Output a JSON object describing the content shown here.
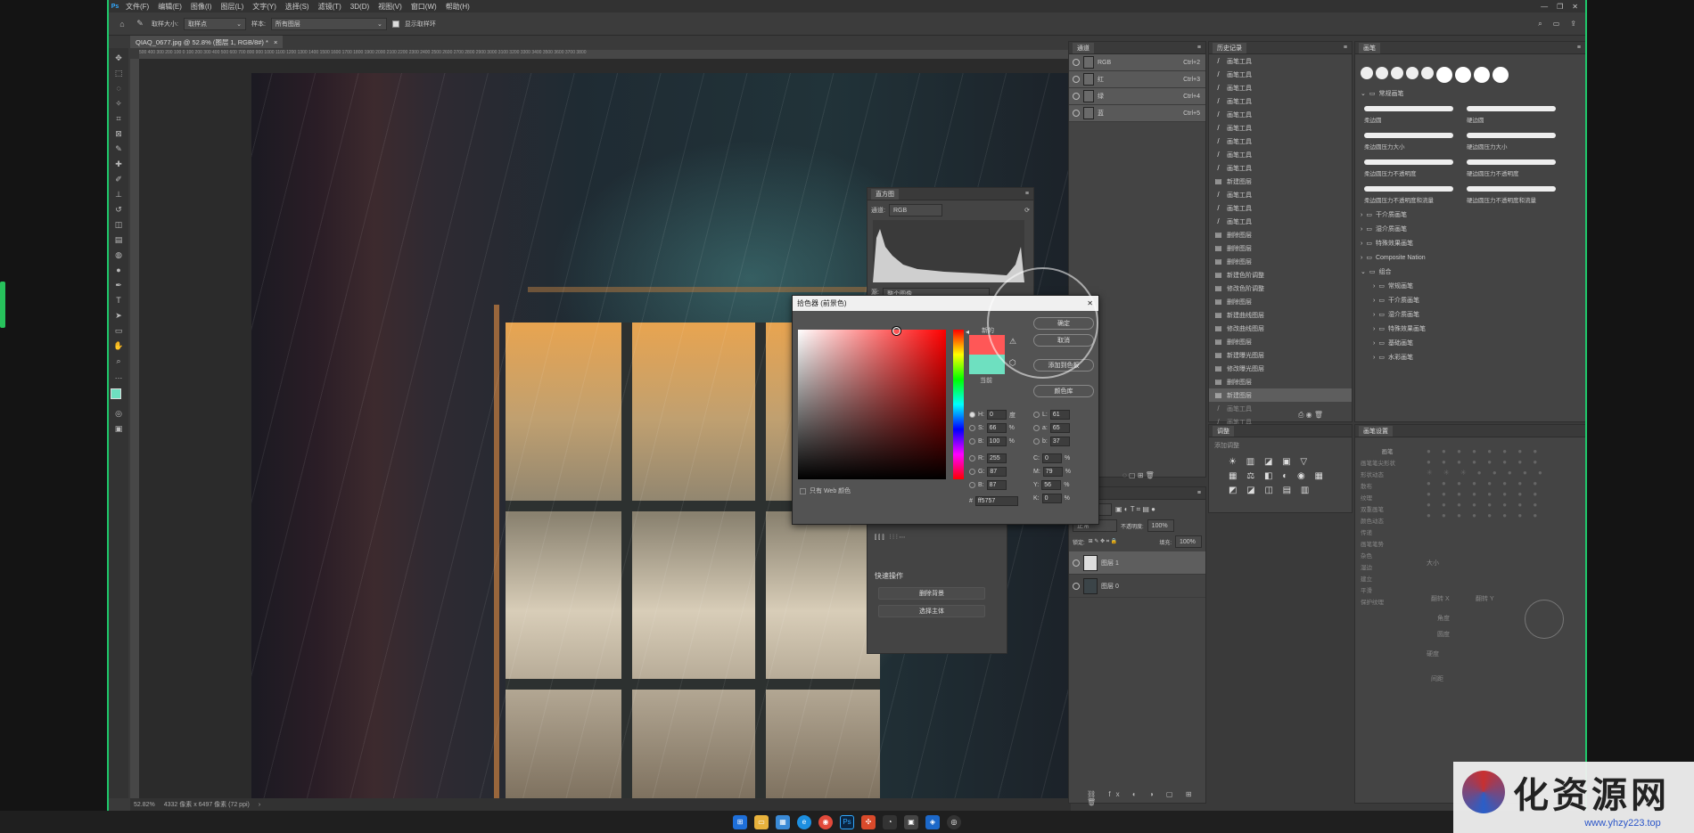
{
  "menu": [
    "文件(F)",
    "编辑(E)",
    "图像(I)",
    "图层(L)",
    "文字(Y)",
    "选择(S)",
    "滤镜(T)",
    "3D(D)",
    "视图(V)",
    "窗口(W)",
    "帮助(H)"
  ],
  "options": {
    "sample_size_label": "取样大小:",
    "sample_size": "取样点",
    "sample_label": "样本:",
    "sample": "所有图层",
    "show_ring": "显示取样环"
  },
  "doc_tab": "QIAQ_0677.jpg @ 52.8% (图层 1, RGB/8#) *",
  "ruler_text": "500  400  300  200  100  0  100  200  300  400  500  600  700  800  900  1000  1100  1200  1300  1400  1500  1600  1700  1800  1900  2000  2100  2200  2300  2400  2500  2600  2700  2800  2900  3000  3100  3200  3300  3400  3500  3600  3700  3800",
  "status": {
    "zoom": "52.82%",
    "info": "4332 像素 x 6497 像素 (72 ppi)"
  },
  "channels": {
    "tab": "通道",
    "rows": [
      {
        "name": "RGB",
        "key": "Ctrl+2"
      },
      {
        "name": "红",
        "key": "Ctrl+3"
      },
      {
        "name": "绿",
        "key": "Ctrl+4"
      },
      {
        "name": "蓝",
        "key": "Ctrl+5"
      }
    ]
  },
  "history": {
    "tab": "历史记录",
    "items": [
      "画笔工具",
      "画笔工具",
      "画笔工具",
      "画笔工具",
      "画笔工具",
      "画笔工具",
      "画笔工具",
      "画笔工具",
      "画笔工具",
      "新建图层",
      "画笔工具",
      "画笔工具",
      "画笔工具",
      "删除图层",
      "删除图层",
      "删除图层",
      "新建色阶调整",
      "修改色阶调整",
      "删除图层",
      "新建曲线图层",
      "修改曲线图层",
      "删除图层",
      "新建曝光图层",
      "修改曝光图层",
      "删除图层",
      "新建图层",
      "画笔工具",
      "画笔工具"
    ]
  },
  "brushes": {
    "tab": "画笔",
    "groups": [
      "常规画笔",
      "干介质画笔",
      "湿介质画笔",
      "特殊效果画笔",
      "Composite Nation",
      "组合"
    ],
    "sub": [
      "常规画笔",
      "干介质画笔",
      "湿介质画笔",
      "特殊效果画笔",
      "基础画笔",
      "水彩画笔"
    ],
    "strokes": [
      "柔边圆",
      "硬边圆",
      "柔边圆压力大小",
      "硬边圆压力大小",
      "柔边圆压力不透明度",
      "硬边圆压力不透明度",
      "柔边圆压力不透明度和流量",
      "硬边圆压力不透明度和流量"
    ]
  },
  "histogram": {
    "tab": "直方图",
    "channel_label": "通道:",
    "channel": "RGB",
    "source": "整个图像"
  },
  "adjust": {
    "tab": "调整",
    "label": "添加调整"
  },
  "layers": {
    "tab": "图层",
    "kind": "类型",
    "mode": "正常",
    "opacity_label": "不透明度:",
    "opacity": "100%",
    "lock_label": "锁定:",
    "fill_label": "填充:",
    "fill": "100%",
    "rows": [
      "图层 1",
      "图层 0"
    ]
  },
  "props": {
    "quick": "快速操作",
    "btn1": "删除背景",
    "btn2": "选择主体"
  },
  "brush_settings": {
    "tab": "画笔设置",
    "brush_btn": "画笔",
    "items": [
      "画笔笔尖形状",
      "形状动态",
      "散布",
      "纹理",
      "双重画笔",
      "颜色动态",
      "传递",
      "画笔笔势",
      "杂色",
      "湿边",
      "建立",
      "平滑",
      "保护纹理"
    ],
    "size": "大小",
    "flip_x": "翻转 X",
    "flip_y": "翻转 Y",
    "angle": "角度",
    "roundness": "圆度",
    "hardness": "硬度",
    "spacing": "间距"
  },
  "picker": {
    "title": "拾色器 (前景色)",
    "new": "新的",
    "current": "当前",
    "ok": "确定",
    "cancel": "取消",
    "add": "添加到色板",
    "lib": "颜色库",
    "web": "只有 Web 颜色",
    "H": "0",
    "S": "66",
    "B": "100",
    "R": "255",
    "G": "87",
    "Bv": "87",
    "L": "61",
    "a": "65",
    "b": "37",
    "C": "0",
    "M": "79",
    "Y": "56",
    "K": "0",
    "hex": "ff5757",
    "deg": "度",
    "pct": "%"
  },
  "watermark": {
    "text": "化资源网",
    "url": "www.yhzy223.top"
  },
  "colors": {
    "new": "#ff5757",
    "current": "#6ee0c0",
    "fg": "#6ee0c0"
  }
}
